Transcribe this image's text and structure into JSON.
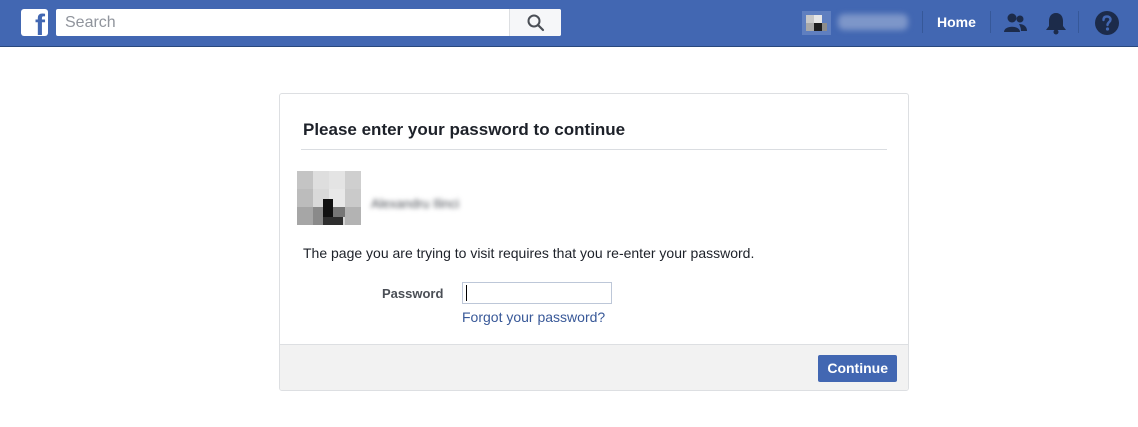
{
  "topbar": {
    "logo_letter": "f",
    "search": {
      "placeholder": "Search",
      "value": ""
    },
    "home_label": "Home"
  },
  "dialog": {
    "title": "Please enter your password to continue",
    "user_name": "Alexandru Ilinci",
    "description": "The page you are trying to visit requires that you re-enter your password.",
    "password_label": "Password",
    "password_value": "",
    "forgot_link": "Forgot your password?",
    "continue_label": "Continue"
  },
  "colors": {
    "brand": "#4267b2",
    "link": "#385898",
    "footer_bg": "#f2f2f2"
  },
  "icons": [
    "facebook-logo-icon",
    "search-icon",
    "friends-icon",
    "bell-icon",
    "help-icon"
  ]
}
